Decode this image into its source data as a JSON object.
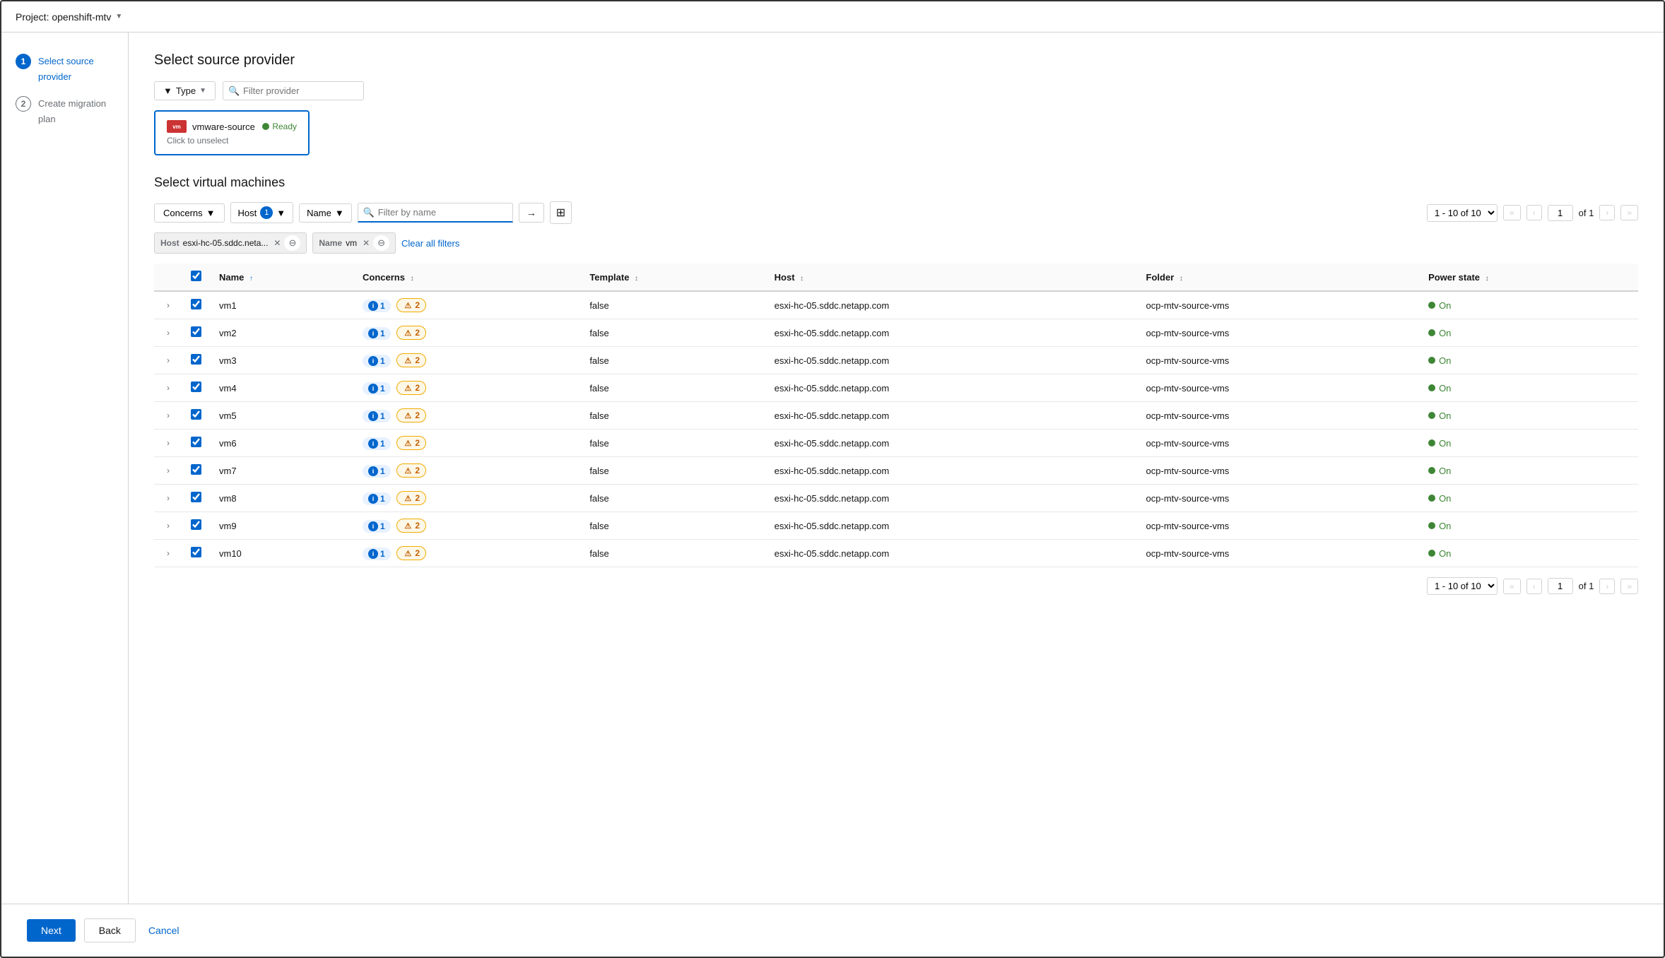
{
  "topbar": {
    "project_label": "Project: openshift-mtv",
    "caret": "▼"
  },
  "sidebar": {
    "steps": [
      {
        "number": "1",
        "label": "Select source provider",
        "state": "active"
      },
      {
        "number": "2",
        "label": "Create migration plan",
        "state": "inactive"
      }
    ]
  },
  "provider_section": {
    "title": "Select source provider",
    "type_filter_label": "Type",
    "filter_placeholder": "Filter provider",
    "provider": {
      "name": "vmware-source",
      "status": "Ready",
      "unselect_label": "Click to unselect"
    }
  },
  "vm_section": {
    "title": "Select virtual machines",
    "concerns_filter_label": "Concerns",
    "host_filter_label": "Host",
    "host_count": "1",
    "name_filter_label": "Name",
    "search_placeholder": "Filter by name",
    "pagination": {
      "range": "1 - 10 of 10",
      "per_page": "10",
      "current_page": "1",
      "of_pages": "of 1"
    },
    "active_filters": [
      {
        "key": "Host",
        "value": "esxi-hc-05.sddc.neta...",
        "id": "host-chip"
      },
      {
        "key": "Name",
        "value": "vm",
        "id": "name-chip"
      }
    ],
    "clear_all_label": "Clear all filters",
    "table": {
      "columns": [
        {
          "label": "Name",
          "sort": "asc",
          "key": "name"
        },
        {
          "label": "Concerns",
          "sort": "none",
          "key": "concerns"
        },
        {
          "label": "Template",
          "sort": "none",
          "key": "template"
        },
        {
          "label": "Host",
          "sort": "none",
          "key": "host"
        },
        {
          "label": "Folder",
          "sort": "none",
          "key": "folder"
        },
        {
          "label": "Power state",
          "sort": "none",
          "key": "power_state"
        }
      ],
      "rows": [
        {
          "name": "vm1",
          "concerns_info": 1,
          "concerns_warn": 2,
          "template": "false",
          "host": "esxi-hc-05.sddc.netapp.com",
          "folder": "ocp-mtv-source-vms",
          "power_state": "On"
        },
        {
          "name": "vm2",
          "concerns_info": 1,
          "concerns_warn": 2,
          "template": "false",
          "host": "esxi-hc-05.sddc.netapp.com",
          "folder": "ocp-mtv-source-vms",
          "power_state": "On"
        },
        {
          "name": "vm3",
          "concerns_info": 1,
          "concerns_warn": 2,
          "template": "false",
          "host": "esxi-hc-05.sddc.netapp.com",
          "folder": "ocp-mtv-source-vms",
          "power_state": "On"
        },
        {
          "name": "vm4",
          "concerns_info": 1,
          "concerns_warn": 2,
          "template": "false",
          "host": "esxi-hc-05.sddc.netapp.com",
          "folder": "ocp-mtv-source-vms",
          "power_state": "On"
        },
        {
          "name": "vm5",
          "concerns_info": 1,
          "concerns_warn": 2,
          "template": "false",
          "host": "esxi-hc-05.sddc.netapp.com",
          "folder": "ocp-mtv-source-vms",
          "power_state": "On"
        },
        {
          "name": "vm6",
          "concerns_info": 1,
          "concerns_warn": 2,
          "template": "false",
          "host": "esxi-hc-05.sddc.netapp.com",
          "folder": "ocp-mtv-source-vms",
          "power_state": "On"
        },
        {
          "name": "vm7",
          "concerns_info": 1,
          "concerns_warn": 2,
          "template": "false",
          "host": "esxi-hc-05.sddc.netapp.com",
          "folder": "ocp-mtv-source-vms",
          "power_state": "On"
        },
        {
          "name": "vm8",
          "concerns_info": 1,
          "concerns_warn": 2,
          "template": "false",
          "host": "esxi-hc-05.sddc.netapp.com",
          "folder": "ocp-mtv-source-vms",
          "power_state": "On"
        },
        {
          "name": "vm9",
          "concerns_info": 1,
          "concerns_warn": 2,
          "template": "false",
          "host": "esxi-hc-05.sddc.netapp.com",
          "folder": "ocp-mtv-source-vms",
          "power_state": "On"
        },
        {
          "name": "vm10",
          "concerns_info": 1,
          "concerns_warn": 2,
          "template": "false",
          "host": "esxi-hc-05.sddc.netapp.com",
          "folder": "ocp-mtv-source-vms",
          "power_state": "On"
        }
      ]
    }
  },
  "footer": {
    "next_label": "Next",
    "back_label": "Back",
    "cancel_label": "Cancel"
  }
}
